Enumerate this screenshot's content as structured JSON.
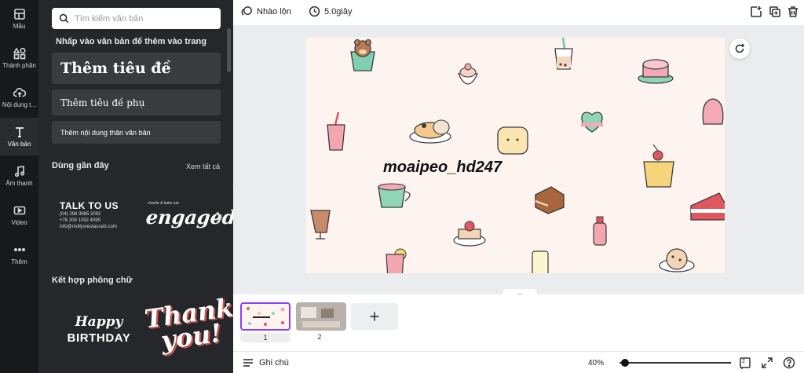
{
  "sidebar": {
    "items": [
      {
        "label": "Mẫu",
        "icon": "layout-icon"
      },
      {
        "label": "Thành phần",
        "icon": "shapes-icon"
      },
      {
        "label": "Nội dung t...",
        "icon": "upload-cloud-icon"
      },
      {
        "label": "Văn bản",
        "icon": "text-icon"
      },
      {
        "label": "Âm thanh",
        "icon": "music-icon"
      },
      {
        "label": "Video",
        "icon": "video-icon"
      },
      {
        "label": "Thêm",
        "icon": "more-icon"
      }
    ]
  },
  "panel": {
    "search_placeholder": "Tìm kiếm văn bản",
    "hint": "Nhấp vào văn bản để thêm vào trang",
    "add_heading": "Thêm tiêu đề",
    "add_subheading": "Thêm tiêu đề phụ",
    "add_body": "Thêm nội dung thân văn bản",
    "recent_title": "Dùng gần đây",
    "see_all": "Xem tất cả",
    "recent_cards": {
      "talk_title": "TALK TO US",
      "talk_lines": [
        "(04) 298 3985 2092",
        "+76 209 1092 4095",
        "info@mollysrestaurant.com"
      ],
      "engaged_small": "charlie & katie are",
      "engaged_big": "engaged!"
    },
    "combos_title": "Kết hợp phông chữ",
    "combo_cards": {
      "happy_1": "Happy",
      "happy_2": "BIRTHDAY",
      "thanks_1": "Thank",
      "thanks_2": "you!"
    }
  },
  "topbar": {
    "animate": "Nhào lộn",
    "duration": "5.0giây"
  },
  "canvas": {
    "text": "moaipeo_hd247"
  },
  "pages": {
    "numbers": [
      "1",
      "2"
    ]
  },
  "bottombar": {
    "notes": "Ghi chú",
    "zoom": "40%",
    "zoom_fraction": 0.05,
    "page_count": "2"
  },
  "colors": {
    "accent": "#8b3dff",
    "rail_bg": "#18191b",
    "panel_bg": "#26272a",
    "design_bg": "#fdf3ef"
  }
}
